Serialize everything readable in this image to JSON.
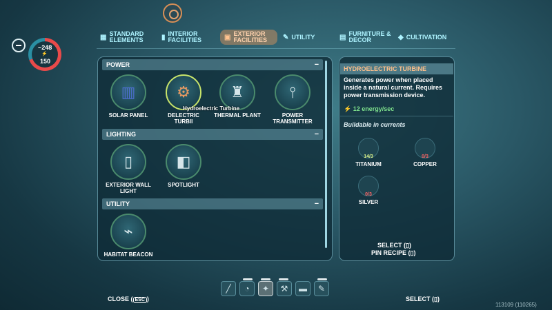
{
  "tabs": [
    {
      "label": "STANDARD ELEMENTS",
      "icon": "standard-elements-icon",
      "active": false
    },
    {
      "label": "INTERIOR FACILITIES",
      "icon": "interior-facilities-icon",
      "active": false
    },
    {
      "label": "EXTERIOR FACILITIES",
      "icon": "exterior-facilities-icon",
      "active": true
    },
    {
      "label": "UTILITY",
      "icon": "wrench-icon",
      "active": false
    },
    {
      "label": "FURNITURE & DECOR",
      "icon": "furniture-icon",
      "active": false
    },
    {
      "label": "CULTIVATION",
      "icon": "cultivation-icon",
      "active": false
    }
  ],
  "hud": {
    "top_value": "248",
    "bottom_value": "150"
  },
  "categories": {
    "power": {
      "label": "POWER",
      "collapse": "−"
    },
    "lighting": {
      "label": "LIGHTING",
      "collapse": "−"
    },
    "utility": {
      "label": "UTILITY",
      "collapse": "−"
    }
  },
  "items": {
    "solar_panel": "SOLAR PANEL",
    "hydroelectric": "DELECTRIC TURBII",
    "thermal": "THERMAL PLANT",
    "power_transmitter": "POWER TRANSMITTER",
    "exterior_wall_light": "EXTERIOR WALL LIGHT",
    "spotlight": "SPOTLIGHT",
    "habitat_beacon": "HABITAT BEACON"
  },
  "tooltip": "Hydroelectric Turbine",
  "detail": {
    "title": "HYDROELECTRIC TURBINE",
    "description": "Generates power when placed inside a natural current. Requires power transmission device.",
    "energy": "12 energy/sec",
    "buildable": "Buildable in currents",
    "resources": [
      {
        "name": "TITANIUM",
        "count": "14/3",
        "ok": true
      },
      {
        "name": "COPPER",
        "count": "0/3",
        "ok": false
      },
      {
        "name": "SILVER",
        "count": "0/3",
        "ok": false
      }
    ],
    "select_hint": "SELECT (",
    "pin_hint": "PIN RECIPE (",
    "close_paren": ")"
  },
  "bottom": {
    "close_label": "CLOSE (",
    "close_key": "ESC",
    "select_label": "SELECT (",
    "close_paren": ")"
  },
  "version": "113109 (110265)",
  "colors": {
    "accent": "#ffc08a",
    "ok": "#7fe28d",
    "bad": "#ff6464"
  }
}
